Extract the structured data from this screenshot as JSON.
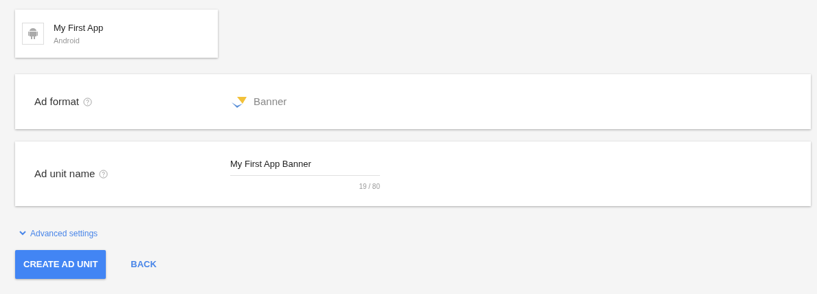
{
  "app": {
    "name": "My First App",
    "platform": "Android"
  },
  "ad_format": {
    "label": "Ad format",
    "value": "Banner"
  },
  "ad_unit_name": {
    "label": "Ad unit name",
    "value": "My First App Banner",
    "counter": "19 / 80"
  },
  "advanced": {
    "label": "Advanced settings",
    "expanded": false
  },
  "buttons": [
    {
      "label": "CREATE AD UNIT",
      "kind": "primary"
    },
    {
      "label": "BACK",
      "kind": "flat"
    }
  ]
}
